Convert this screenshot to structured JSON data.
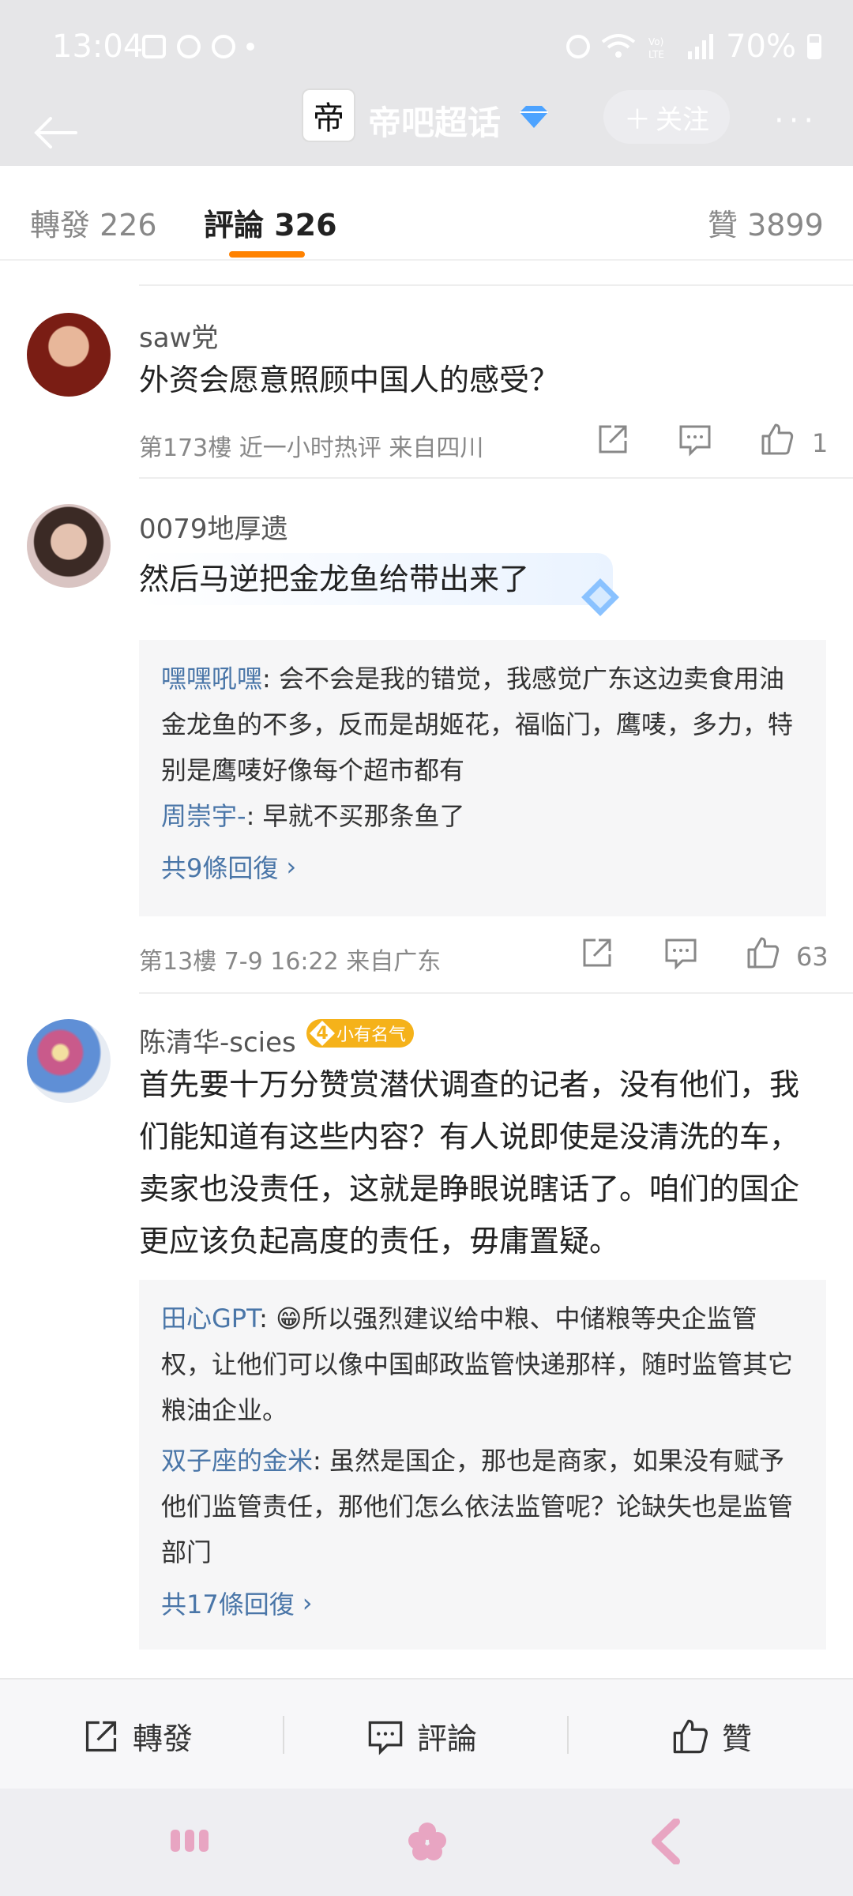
{
  "status": {
    "time": "13:04",
    "battery": "70%"
  },
  "nav": {
    "topic_title": "帝吧超话",
    "topic_avatar_char": "帝",
    "follow_label": "关注",
    "more": "···"
  },
  "tabs": {
    "repost": "轉發 226",
    "comments": "評論 326",
    "likes": "贊 3899"
  },
  "comments": [
    {
      "user": "saw党",
      "text": "外资会愿意照顾中国人的感受？",
      "meta": "第173樓  近一小时热评  来自四川",
      "likes": "1"
    },
    {
      "user": "0079地厚遗",
      "text": "然后马逆把金龙鱼给带出来了",
      "replies": [
        {
          "name": "嘿嘿吼嘿",
          "text": ": 会不会是我的错觉，我感觉广东这边卖食用油金龙鱼的不多，反而是胡姬花，福临门，鹰唛，多力，特别是鹰唛好像每个超市都有"
        },
        {
          "name": "周崇宇-",
          "text": ": 早就不买那条鱼了"
        }
      ],
      "more_replies": "共9條回復",
      "meta": "第13樓  7-9 16:22  来自广东",
      "likes": "63"
    },
    {
      "user": "陈清华-scies",
      "badge_level": "4",
      "badge_text": "小有名气",
      "text": "首先要十万分赞赏潜伏调查的记者，没有他们，我们能知道有这些内容？有人说即使是没清洗的车，卖家也没责任，这就是睁眼说瞎话了。咱们的国企更应该负起高度的责任，毋庸置疑。",
      "replies": [
        {
          "name": "田心GPT",
          "text": ": 😁所以强烈建议给中粮、中储粮等央企监管权，让他们可以像中国邮政监管快递那样，随时监管其它粮油企业。"
        },
        {
          "name": "双子座的金米",
          "text": ": 虽然是国企，那也是商家，如果没有赋予他们监管责任，那他们怎么依法监管呢？论缺失也是监管部门"
        }
      ],
      "more_replies": "共17條回復"
    }
  ],
  "bottom_bar": {
    "repost": "轉發",
    "comment": "評論",
    "like": "贊"
  },
  "colors": {
    "accent": "#ff8200",
    "link": "#4a76a8",
    "badge": "#f5b21a"
  }
}
